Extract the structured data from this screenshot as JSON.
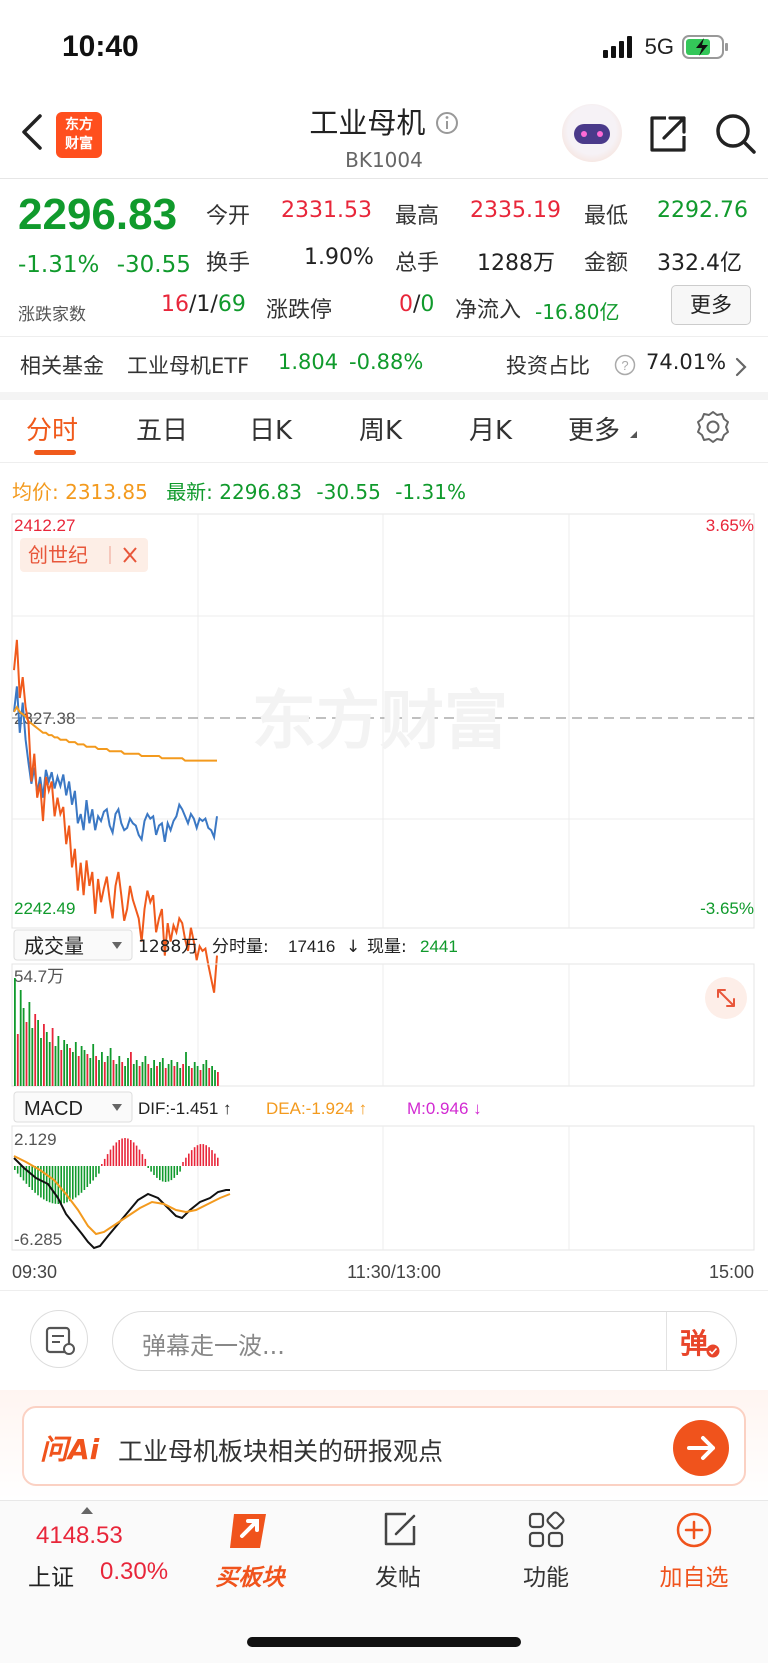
{
  "status": {
    "time": "10:40",
    "network": "5G"
  },
  "header": {
    "logo_text": "东方财富",
    "title": "工业母机",
    "code": "BK1004"
  },
  "quote": {
    "price": "2296.83",
    "change_pct": "-1.31%",
    "change": "-30.55",
    "open_label": "今开",
    "open": "2331.53",
    "high_label": "最高",
    "high": "2335.19",
    "low_label": "最低",
    "low": "2292.76",
    "turnover_label": "换手",
    "turnover": "1.90%",
    "volume_label": "总手",
    "volume": "1288万",
    "amount_label": "金额",
    "amount": "332.4亿",
    "breadth_label": "涨跌家数",
    "up": "16",
    "flat": "1",
    "down": "69",
    "sep": "/",
    "limit_label": "涨跌停",
    "limit_up": "0",
    "limit_down": "0",
    "netflow_label": "净流入",
    "netflow": "-16.80亿",
    "more_button": "更多"
  },
  "fund": {
    "label": "相关基金",
    "name": "工业母机ETF",
    "price": "1.804",
    "change": "-0.88%",
    "ratio_label": "投资占比",
    "ratio": "74.01%"
  },
  "tabs": [
    "分时",
    "五日",
    "日K",
    "周K",
    "月K",
    "更多"
  ],
  "active_tab": 0,
  "info_line": {
    "avg_label": "均价:",
    "avg": "2313.85",
    "latest_label": "最新:",
    "latest": "2296.83",
    "change": "-30.55",
    "change_pct": "-1.31%"
  },
  "chart_data": {
    "type": "line",
    "title": "",
    "price_axis": {
      "max": "2412.27",
      "mid": "2327.38",
      "min": "2242.49",
      "max_pct": "3.65%",
      "min_pct": "-3.65%"
    },
    "watermark": "东方财富",
    "tag": "创世纪",
    "series": [
      {
        "name": "price",
        "color": "#3b78c4",
        "values": [
          2327,
          2338,
          2318,
          2331,
          2315,
          2305,
          2296,
          2303,
          2292,
          2299,
          2290,
          2302,
          2297,
          2301,
          2294,
          2299,
          2295,
          2300,
          2291,
          2297,
          2287,
          2293,
          2279,
          2283,
          2276,
          2289,
          2279,
          2285,
          2276,
          2282,
          2280,
          2284,
          2285,
          2278,
          2275,
          2283,
          2285,
          2279,
          2276,
          2277,
          2281,
          2279,
          2278,
          2274,
          2272,
          2280,
          2283,
          2281,
          2282,
          2274,
          2278,
          2279,
          2271,
          2279,
          2276,
          2280,
          2282,
          2287,
          2285,
          2282,
          2279,
          2283,
          2281,
          2277,
          2281,
          2280,
          2281,
          2277,
          2276,
          2273,
          2282
        ]
      },
      {
        "name": "avg",
        "color": "#f39a1e",
        "values": [
          2327,
          2329,
          2327,
          2326,
          2325,
          2323,
          2322,
          2321,
          2320,
          2319,
          2318,
          2318,
          2317,
          2317,
          2316,
          2316,
          2315,
          2315,
          2315,
          2314,
          2314,
          2314,
          2313,
          2313,
          2313,
          2312,
          2312,
          2312,
          2312,
          2311,
          2311,
          2311,
          2311,
          2310,
          2310,
          2310,
          2310,
          2310,
          2309,
          2309,
          2309,
          2309,
          2309,
          2309,
          2308,
          2308,
          2308,
          2308,
          2308,
          2308,
          2308,
          2307,
          2307,
          2307,
          2307,
          2307,
          2307,
          2307,
          2307,
          2306,
          2306,
          2306,
          2306,
          2306,
          2306,
          2306,
          2306,
          2306,
          2306,
          2306,
          2306
        ]
      },
      {
        "name": "stock",
        "color": "#f05a1c",
        "values": [
          2345,
          2358,
          2333,
          2342,
          2329,
          2322,
          2297,
          2309,
          2290,
          2296,
          2280,
          2299,
          2293,
          2297,
          2282,
          2290,
          2283,
          2286,
          2270,
          2278,
          2260,
          2268,
          2250,
          2262,
          2248,
          2263,
          2252,
          2258,
          2240,
          2255,
          2245,
          2251,
          2256,
          2246,
          2238,
          2252,
          2258,
          2248,
          2237,
          2242,
          2252,
          2246,
          2242,
          2238,
          2228,
          2242,
          2250,
          2245,
          2248,
          2232,
          2238,
          2242,
          2222,
          2236,
          2228,
          2235,
          2232,
          2238,
          2236,
          2229,
          2224,
          2234,
          2228,
          2220,
          2226,
          2224,
          2225,
          2218,
          2212,
          2206,
          2222
        ]
      }
    ],
    "volume": {
      "label": "成交量",
      "total": "1288万",
      "minute_label": "分时量:",
      "minute": "17416",
      "now_label": "现量:",
      "now": "2441",
      "max": "54.7万"
    },
    "macd": {
      "label": "MACD",
      "dif": "DIF:-1.451",
      "dea": "DEA:-1.924",
      "m": "M:0.946",
      "max": "2.129",
      "min": "-6.285"
    },
    "time_axis": [
      "09:30",
      "11:30/13:00",
      "15:00"
    ]
  },
  "danmaku": {
    "placeholder": "弹幕走一波...",
    "send": "弹"
  },
  "ai": {
    "logo": "问Ai",
    "text": "工业母机板块相关的研报观点"
  },
  "bottom_nav": {
    "index_value": "4148.53",
    "index_name": "上证",
    "index_change": "0.30%",
    "buy_label": "买板块",
    "post_label": "发帖",
    "func_label": "功能",
    "add_label": "加自选"
  }
}
